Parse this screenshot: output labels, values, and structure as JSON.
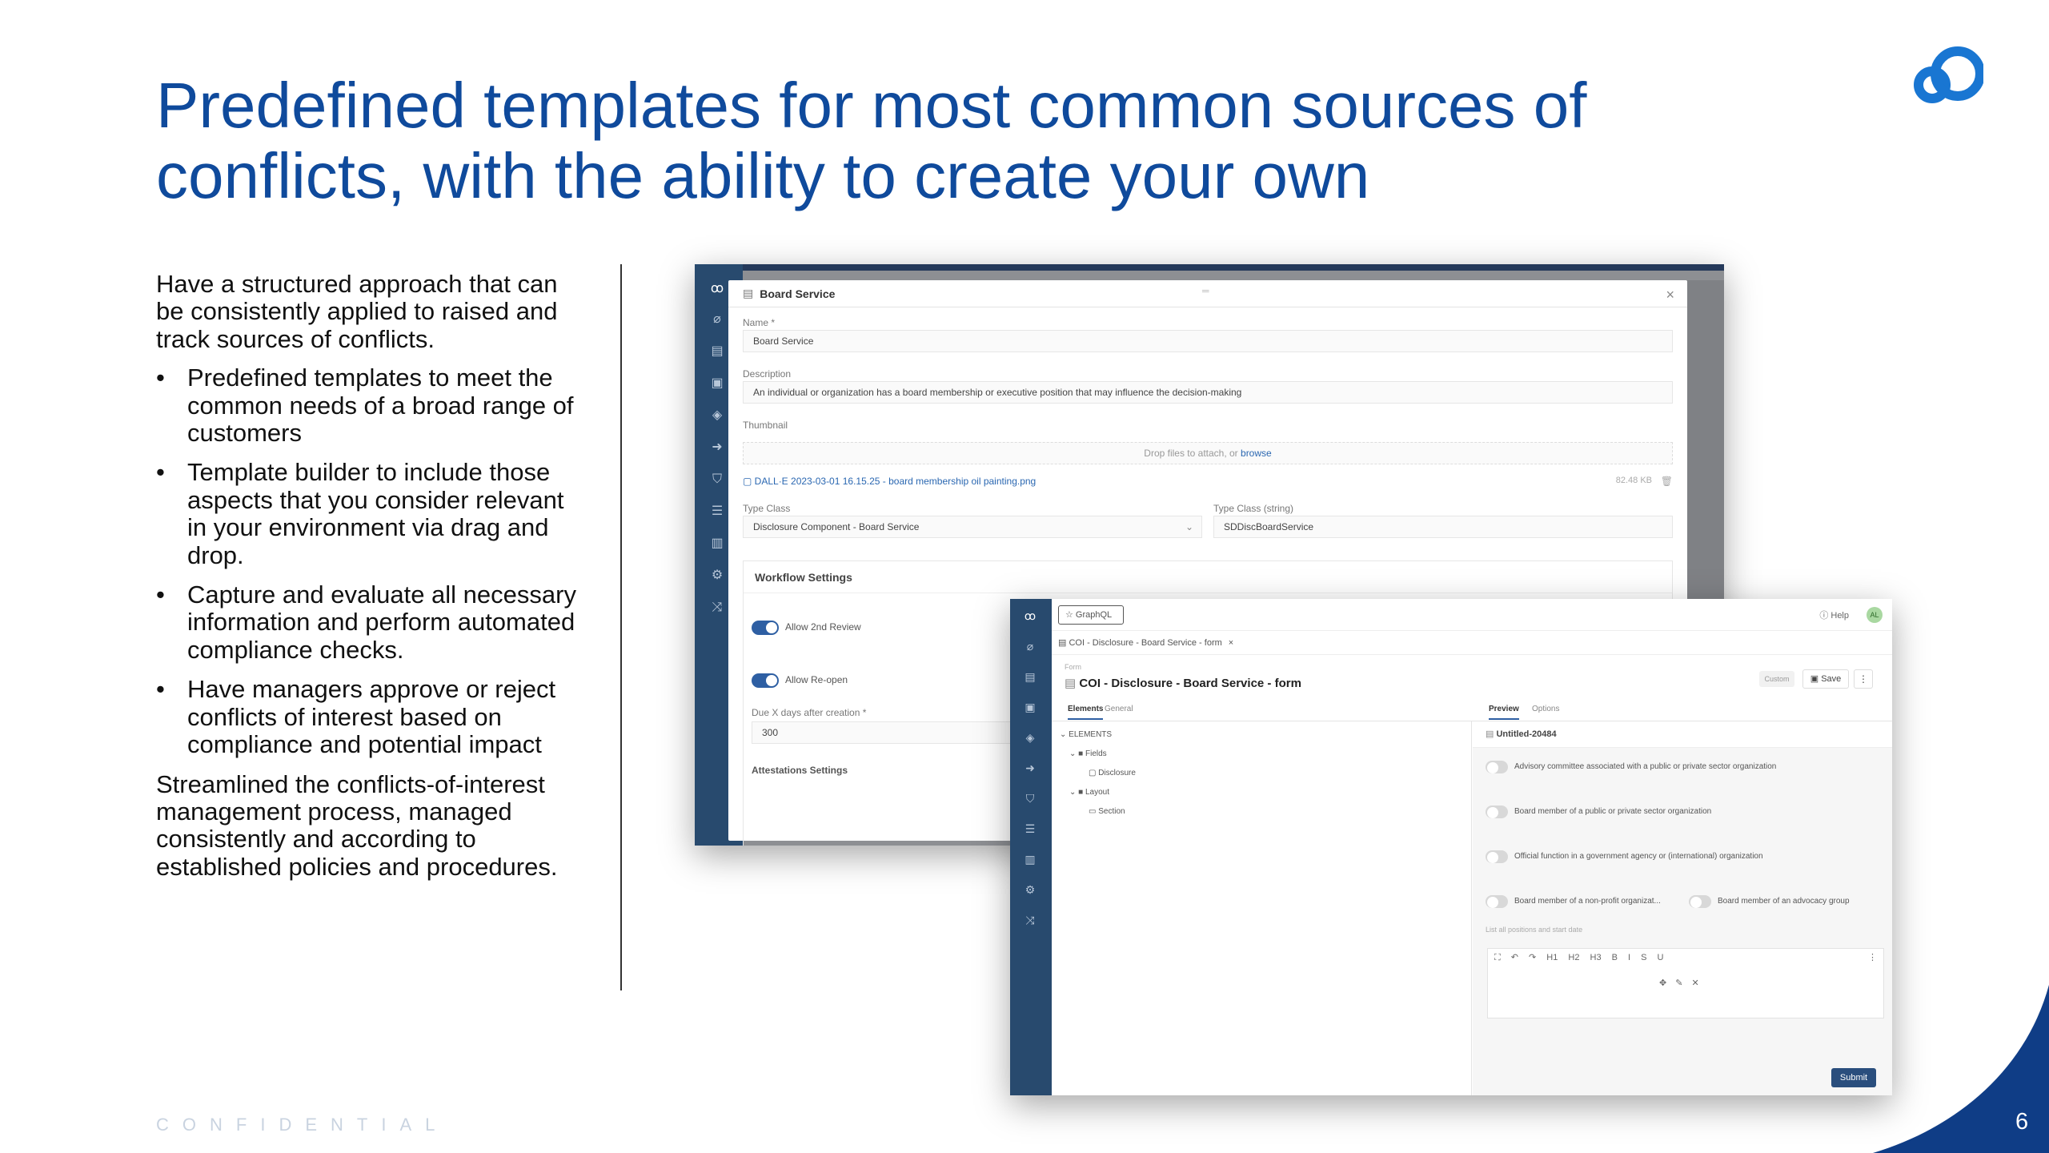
{
  "slide": {
    "title": "Predefined templates for most common sources of conflicts, with the ability to create your own",
    "intro": "Have a structured approach that can be consistently applied to raised and track sources of conflicts.",
    "bullets": [
      "Predefined templates to meet the common needs of a broad range of customers",
      "Template builder to include those aspects that you consider relevant in your environment via drag and drop.",
      "Capture and evaluate all necessary information and perform automated compliance checks.",
      "Have managers approve or reject conflicts of interest based on compliance and potential impact"
    ],
    "bullet_char": "•",
    "closing": "Streamlined the conflicts-of-interest management process, managed consistently and according to established policies and procedures.",
    "footer": "CONFIDENTIAL",
    "page_number": "6",
    "brand_color": "#0f4a9c"
  },
  "screen1": {
    "modal_title": "Board Service",
    "close_glyph": "×",
    "handle_glyph": "═",
    "name_label": "Name *",
    "name_value": "Board Service",
    "description_label": "Description",
    "description_value": "An individual or organization has a board membership or executive position that may influence the decision-making",
    "thumbnail_label": "Thumbnail",
    "drop_text": "Drop files to attach, or ",
    "drop_link": "browse",
    "file_name": "DALL·E 2023-03-01 16.15.25 - board membership oil painting.png",
    "file_size": "82.48 KB",
    "type_class_label": "Type Class",
    "type_class_value": "Disclosure Component - Board Service",
    "type_class_string_label": "Type Class (string)",
    "type_class_string_value": "SDDiscBoardService",
    "workflow_title": "Workflow Settings",
    "allow_2nd_review": "Allow 2nd Review",
    "allow_reopen": "Allow Re-open",
    "due_label": "Due X days after creation *",
    "due_value": "300",
    "attestations_title": "Attestations Settings"
  },
  "screen2": {
    "graphql_label": "GraphQL",
    "help_label": "Help",
    "avatar_initials": "AL",
    "doc_tab": "COI - Disclosure - Board Service - form",
    "form_small_label": "Form",
    "form_title": "COI - Disclosure - Board Service - form",
    "custom_badge": "Custom",
    "save_label": "Save",
    "tab_elements": "Elements",
    "tab_general": "General",
    "tab_preview": "Preview",
    "tab_options": "Options",
    "tree_elements": "ELEMENTS",
    "tree_fields": "Fields",
    "tree_disclosure": "Disclosure",
    "tree_layout": "Layout",
    "tree_section": "Section",
    "preview_name": "Untitled-20484",
    "options": [
      "Advisory committee associated with a public or private sector organization",
      "Board member of a public or private sector organization",
      "Official function in a government agency or (international) organization",
      "Board member of a non-profit organizat...",
      "Board member of an advocacy group"
    ],
    "positions_label": "List all positions and start date",
    "rte_toolbar": "⛶ ↶ ↷ H1 H2 H3 B I S U",
    "rte_tools": "✥ ✎ ✕",
    "submit_label": "Submit"
  }
}
